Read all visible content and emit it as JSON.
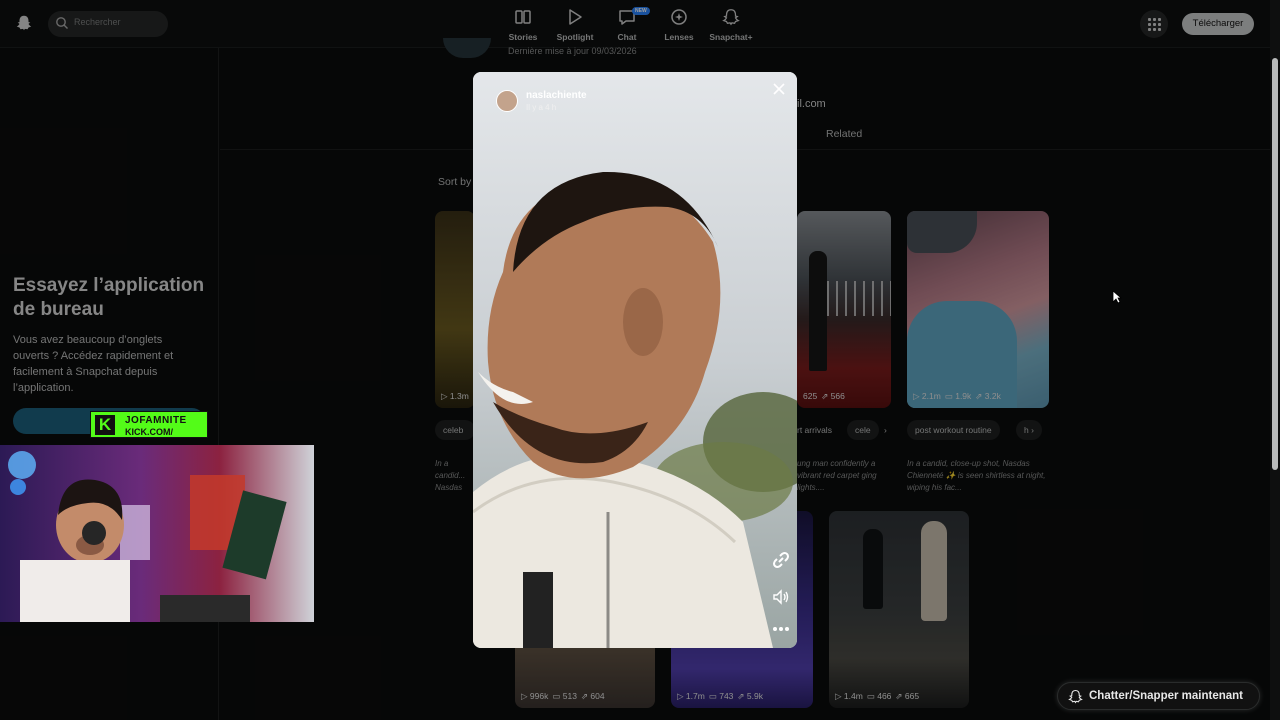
{
  "header": {
    "search_placeholder": "Rechercher",
    "nav": [
      {
        "label": "Stories",
        "icon": "stories-icon"
      },
      {
        "label": "Spotlight",
        "icon": "play-icon"
      },
      {
        "label": "Chat",
        "icon": "chat-icon",
        "badge": "NEW"
      },
      {
        "label": "Lenses",
        "icon": "lenses-icon"
      },
      {
        "label": "Snapchat+",
        "icon": "snapchat-plus-icon"
      }
    ],
    "download_label": "Télécharger"
  },
  "sidebar": {
    "promo_title": "Essayez l’application de bureau",
    "promo_text": "Vous avez beaucoup d’onglets ouverts ? Accédez rapidement et facilement à Snapchat depuis l’application."
  },
  "stream_overlay": {
    "kick_line1": "JOFAMNITE",
    "kick_line2": "KICK.COM/"
  },
  "profile": {
    "last_update": "Dernière mise à jour 09/03/2026",
    "email_fragment": "il.com",
    "related_tab": "Related",
    "sort_label": "Sort by"
  },
  "cards_row1": [
    {
      "stats": {
        "views": "1.3m"
      },
      "chip": "celeb",
      "desc": "In a candid... Nasdas C... a victory v..."
    },
    {
      "stats": {
        "comments": "625",
        "shares": "566"
      },
      "chips": [
        "rt arrivals",
        "cele"
      ],
      "desc": "ung man confidently a vibrant red carpet ging lights...."
    },
    {
      "stats": {
        "views": "2.1m",
        "comments": "1.9k",
        "shares": "3.2k"
      },
      "chips": [
        "post workout routine",
        "h"
      ],
      "desc": "In a candid, close-up shot, Nasdas Chienneté ✨ is seen shirtless at night, wiping his fac..."
    }
  ],
  "cards_row2": [
    {
      "views": "996k",
      "comments": "513",
      "shares": "604"
    },
    {
      "views": "1.7m",
      "comments": "743",
      "shares": "5.9k"
    },
    {
      "views": "1.4m",
      "comments": "466",
      "shares": "665"
    }
  ],
  "modal": {
    "username": "naslachiente",
    "time": "Il y a 4 h"
  },
  "chat_button": "Chatter/Snapper maintenant",
  "colors": {
    "background": "#0b0c0c",
    "accent_blue": "#2b85ff",
    "kick_green": "#53fc18",
    "download_button": "#c9cbcb"
  }
}
